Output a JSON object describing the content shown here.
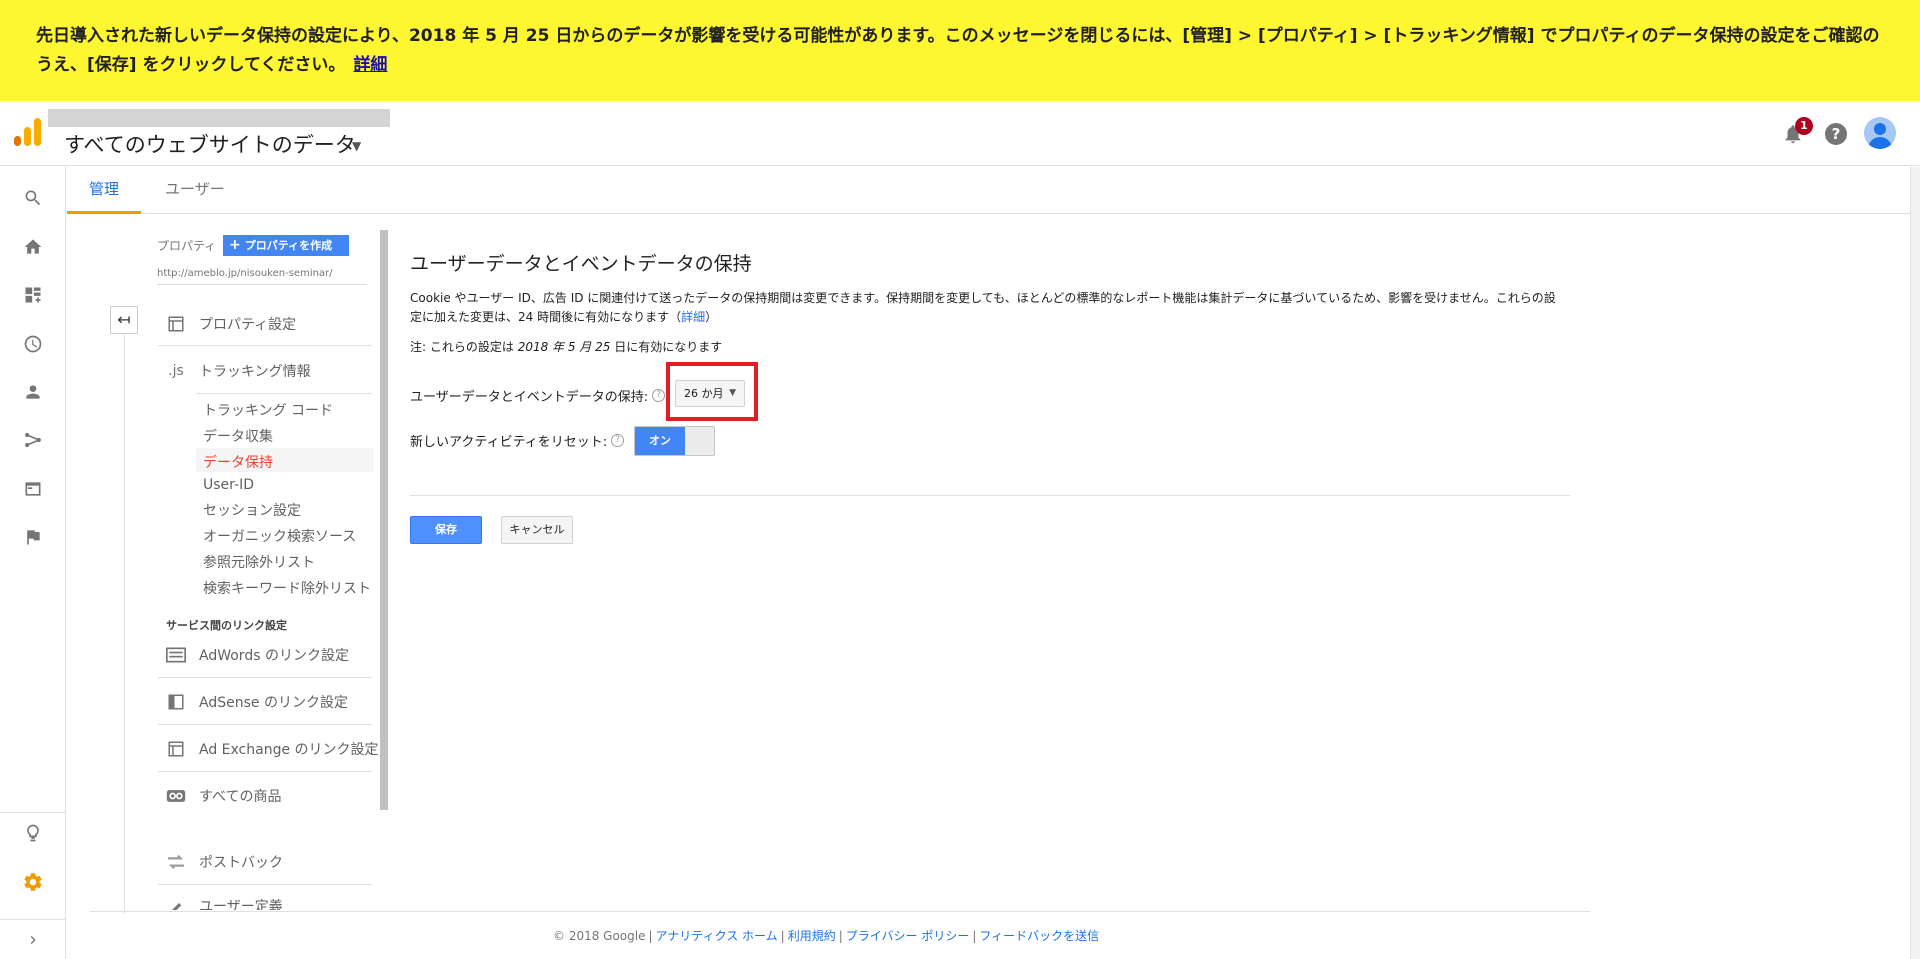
{
  "banner": {
    "message": "先日導入された新しいデータ保持の設定により、2018 年 5 月 25 日からのデータが影響を受ける可能性があります。このメッセージを閉じるには、[管理] > [プロパティ] > [トラッキング情報] でプロパティのデータ保持の設定をご確認のうえ、[保存] をクリックしてください。",
    "link": "詳細",
    "background": "#fff632"
  },
  "header": {
    "account_title": "すべてのウェブサイトのデータ",
    "notification_count": "1",
    "help": "?"
  },
  "tabs": [
    {
      "label": "管理"
    },
    {
      "label": "ユーザー"
    }
  ],
  "property": {
    "label": "プロパティ",
    "create_button": "プロパティを作成",
    "url": "http://ameblo.jp/nisouken-seminar/"
  },
  "nav": {
    "property_settings": "プロパティ設定",
    "tracking_info": "トラッキング情報",
    "tracking_code": "トラッキング コード",
    "data_collection": "データ収集",
    "data_retention": "データ保持",
    "user_id": "User-ID",
    "session_settings": "セッション設定",
    "organic_search": "オーガニック検索ソース",
    "referral_exclusion": "参照元除外リスト",
    "search_term_exclusion": "検索キーワード除外リスト",
    "service_links_heading": "サービス間のリンク設定",
    "adwords": "AdWords のリンク設定",
    "adsense": "AdSense のリンク設定",
    "adexchange": "Ad Exchange のリンク設定",
    "all_products": "すべての商品",
    "postback": "ポストバック",
    "user_definitions": "ユーザー定義"
  },
  "main": {
    "title": "ユーザーデータとイベントデータの保持",
    "description": "Cookie やユーザー ID、広告 ID に関連付けて送ったデータの保持期間は変更できます。保持期間を変更しても、ほとんどの標準的なレポート機能は集計データに基づいているため、影響を受けません。これらの設定に加えた変更は、24 時間後に有効になります（",
    "description_link": "詳細",
    "description_end": "）",
    "note_prefix": "注: これらの設定は ",
    "note_date": "2018 年 5 月 25",
    "note_suffix": " 日に有効になります",
    "retention_label": "ユーザーデータとイベントデータの保持:",
    "retention_value": "26 か月",
    "reset_label": "新しいアクティビティをリセット:",
    "reset_toggle": "オン",
    "save": "保存",
    "cancel": "キャンセル"
  },
  "footer": {
    "copyright": "© 2018 Google",
    "links": [
      "アナリティクス ホーム",
      "利用規約",
      "プライバシー ポリシー",
      "フィードバックを送信"
    ]
  },
  "colors": {
    "accent": "#1a73e8",
    "active_tab_underline": "#f29900",
    "active_nav": "#e8452b",
    "highlight_box": "#e51c23",
    "settings_icon": "#f29900"
  }
}
